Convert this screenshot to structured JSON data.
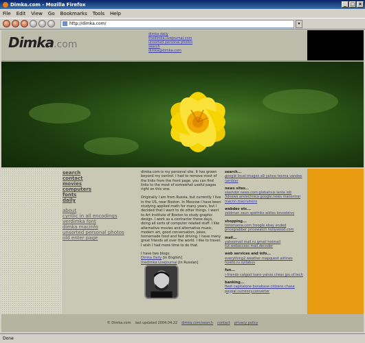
{
  "window": {
    "title": "Dimka.com - Mozilla Firefox"
  },
  "menu": [
    "File",
    "Edit",
    "View",
    "Go",
    "Bookmarks",
    "Tools",
    "Help"
  ],
  "address": {
    "url": "http://dimka.com/"
  },
  "header": {
    "logo_main": "Dimka",
    "logo_tld": ".com",
    "links": [
      "dimka daily",
      "thedimka.livejournal.com",
      "unsorted personal photos",
      "search",
      "dimka@dimka.com"
    ]
  },
  "nav": {
    "primary": [
      "search",
      "contact",
      "movies",
      "computers",
      "fonts",
      "daily"
    ],
    "secondary": [
      "about",
      "cyrillic in all encodings",
      "verdimka font",
      "dimka macinfo",
      "unsorted personal photos",
      "old enter page"
    ]
  },
  "intro": {
    "p1": "dimka.com is my personal site. It has grown beyond my control. I had to remove most of the links from the front page. you can find links to the most of somewhat useful pages right on this one.",
    "p2": "Originally I am from Russia, but currently I live in the US, near Boston. In Moscow I have been studying applied math for many years, but I decided that I want to do other things. I went to Art Institute of Boston to study graphic design. I work as a contractor these days, doing all sorts of computer related stuff. I like alternative movies and alternative music, modern art, good conversation, jokes, homemade food and fast driving. I have many great friends all over the world. I like to travel. I wish I had more time to do that.",
    "blogs_intro": "I have two blogs:",
    "blog1": "Dimka Daily",
    "blog1_lang": "[in English]",
    "blog2": "thedimka LiveJournal",
    "blog2_lang": "[in Russian]"
  },
  "right": [
    {
      "title": "search...",
      "links": "google local-images a9 yahoo teoma vandex rambler"
    },
    {
      "title": "news sites...",
      "links": "slashdot news.com globalnus lenta iolt 3dnews arstechnica google.news macentral macnn macrumors"
    },
    {
      "title": "webdev etc...",
      "links": "zeldman zaun spethiks aiktos kovodstvo"
    },
    {
      "title": "shopping...",
      "links": "tiktomania.com froogle ebay ended pricegrabber pricewatch hollywood.com"
    },
    {
      "title": "mail...",
      "links": "yahoomail mail.ru gmail hotmail tut.webaccess mail.decoder"
    },
    {
      "title": "web services and info...",
      "links": "everything2 weather mapquest airlines howto.ru syllabus"
    },
    {
      "title": "fun...",
      "links": "i-friends catgod tsaro yahoo.chess jpu.of.tech"
    },
    {
      "title": "banking...",
      "links": "fleet capitalone bonabase citizens chase paypal currency.converter"
    }
  ],
  "footer": {
    "copyright": "© Dimka.com",
    "updated": "last updated 2004.04.22",
    "links": [
      "dimka.com/search",
      "contact",
      "privacy policy"
    ]
  },
  "status": {
    "text": "Done"
  },
  "colors": {
    "accent_orange": "#e89a10",
    "flower_yellow": "#f5d400",
    "leaf_green": "#2f5a18"
  }
}
